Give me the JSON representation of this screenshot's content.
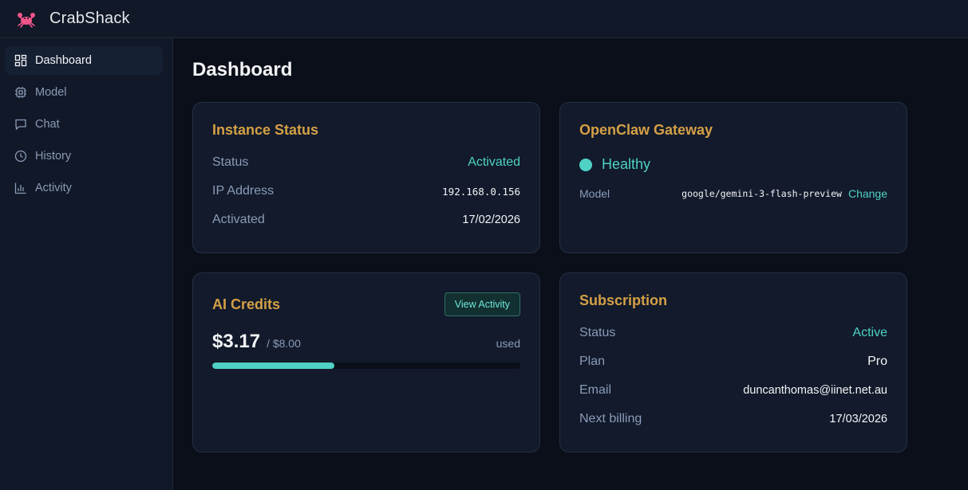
{
  "app": {
    "title": "CrabShack",
    "logo_icon": "crab-icon"
  },
  "sidebar": {
    "items": [
      {
        "label": "Dashboard",
        "icon": "grid-icon",
        "active": true
      },
      {
        "label": "Model",
        "icon": "chip-icon",
        "active": false
      },
      {
        "label": "Chat",
        "icon": "chat-icon",
        "active": false
      },
      {
        "label": "History",
        "icon": "clock-icon",
        "active": false
      },
      {
        "label": "Activity",
        "icon": "bar-chart-icon",
        "active": false
      }
    ]
  },
  "page": {
    "title": "Dashboard"
  },
  "instance": {
    "title": "Instance Status",
    "status_label": "Status",
    "status_value": "Activated",
    "ip_label": "IP Address",
    "ip_value": "192.168.0.156",
    "activated_label": "Activated",
    "activated_value": "17/02/2026"
  },
  "gateway": {
    "title": "OpenClaw Gateway",
    "health": "Healthy",
    "model_label": "Model",
    "model_value": "google/gemini-3-flash-preview",
    "change_label": "Change"
  },
  "credits": {
    "title": "AI Credits",
    "view_button": "View Activity",
    "used_amount": "$3.17",
    "total_amount": "/ $8.00",
    "used_label": "used",
    "fraction_used": 0.396
  },
  "subscription": {
    "title": "Subscription",
    "status_label": "Status",
    "status_value": "Active",
    "plan_label": "Plan",
    "plan_value": "Pro",
    "email_label": "Email",
    "email_value": "duncanthomas@iinet.net.au",
    "billing_label": "Next billing",
    "billing_value": "17/03/2026"
  },
  "colors": {
    "accent": "#4fd1c5",
    "title_gold": "#d4a046",
    "background": "#0b0f19",
    "card": "#121a2b"
  }
}
